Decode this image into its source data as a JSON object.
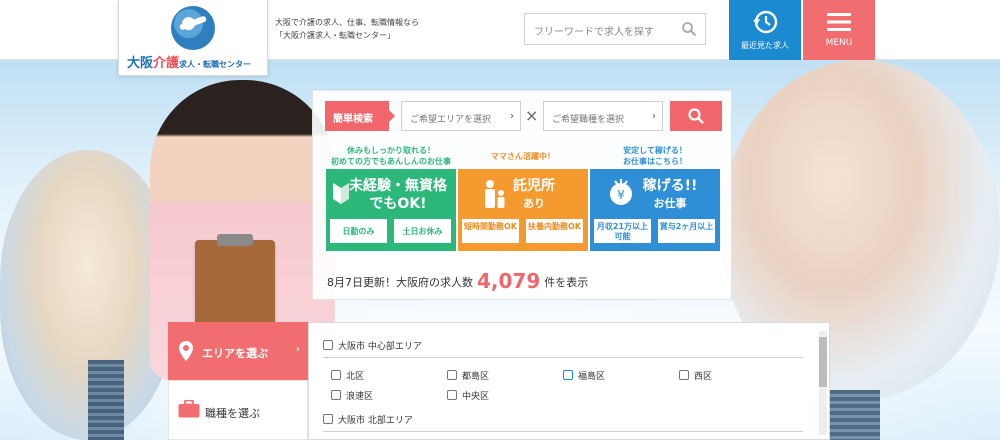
{
  "header": {
    "logo_name_prefix": "大阪",
    "logo_name_accent": "介護",
    "logo_name_suffix": "求人・転職センター",
    "tagline_line1": "大阪で介護の求人、仕事、転職情報なら",
    "tagline_line2": "「大阪介護求人・転職センター」",
    "search_placeholder": "フリーワードで求人を探す",
    "recent_label": "最近見た求人",
    "menu_label": "MENU"
  },
  "quick_search": {
    "label": "簡単検索",
    "area_placeholder": "ご希望エリアを選択",
    "job_placeholder": "ご希望職種を選択",
    "times": "×"
  },
  "categories": [
    {
      "tag_line1": "休みもしっかり取れる！",
      "tag_line2": "初めての方でもあんしんのお仕事",
      "title_line1": "未経験・無資格",
      "title_line2": "でもOK!",
      "buttons": [
        "日勤のみ",
        "土日お休み"
      ]
    },
    {
      "tag_line1": "ママさん活躍中！",
      "title_line1": "託児所",
      "title_line2": "あり",
      "buttons": [
        "短時間勤務OK",
        "扶養内勤務OK"
      ]
    },
    {
      "tag_line1": "安定して稼げる！",
      "tag_line2": "お仕事はこちら！",
      "title_line1": "稼げる!!",
      "title_line2": "お仕事",
      "buttons": [
        "月収21万以上可能",
        "賞与2ヶ月以上"
      ]
    }
  ],
  "job_count": {
    "prefix": "8月7日更新！大阪府の求人数",
    "number": "4,079",
    "suffix": "件を表示"
  },
  "tabs": {
    "area": "エリアを選ぶ",
    "job": "職種を選ぶ"
  },
  "area_list": {
    "regions": [
      "大阪市 中心部エリア",
      "大阪市 北部エリア"
    ],
    "options": [
      "北区",
      "都島区",
      "福島区",
      "西区",
      "浪速区",
      "中央区"
    ]
  },
  "colors": {
    "brand_blue": "#1b8ad0",
    "accent_red": "#f26d6f",
    "green": "#2db87b",
    "orange": "#f59a2f",
    "blue_card": "#2f8fd6"
  }
}
